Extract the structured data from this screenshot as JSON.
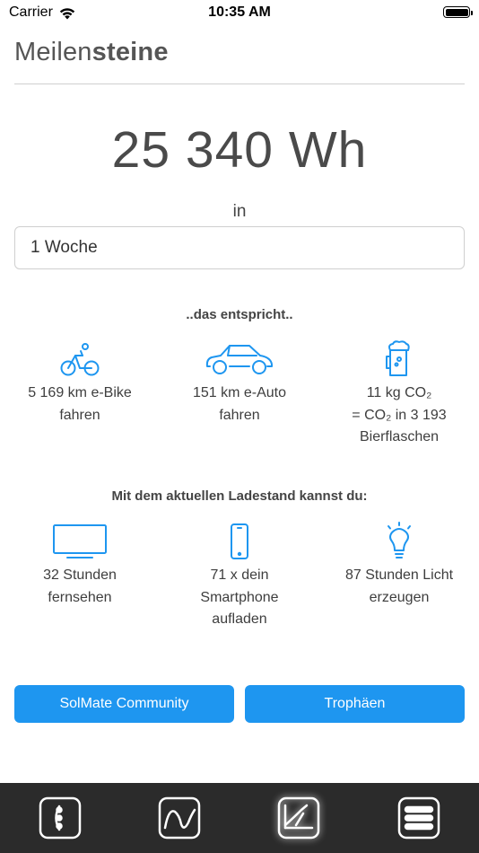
{
  "status_bar": {
    "carrier": "Carrier",
    "time": "10:35 AM"
  },
  "header": {
    "title_regular": "Meilen",
    "title_bold": "steine"
  },
  "energy": {
    "value": "25 340 Wh",
    "in_label": "in"
  },
  "period_select": {
    "value": "1 Woche"
  },
  "equivalents": {
    "heading": "..das entspricht..",
    "items": [
      {
        "icon": "bicycle-icon",
        "lines": [
          "5 169 km e-Bike",
          "fahren"
        ]
      },
      {
        "icon": "car-icon",
        "lines": [
          "151 km e-Auto",
          "fahren"
        ]
      },
      {
        "icon": "beer-mug-icon",
        "lines": [
          "11 kg CO₂",
          "= CO₂ in 3 193",
          "Bierflaschen"
        ]
      }
    ]
  },
  "capabilities": {
    "heading": "Mit dem aktuellen Ladestand kannst du:",
    "items": [
      {
        "icon": "tv-icon",
        "lines": [
          "32 Stunden",
          "fernsehen"
        ]
      },
      {
        "icon": "smartphone-icon",
        "lines": [
          "71 x dein",
          "Smartphone",
          "aufladen"
        ]
      },
      {
        "icon": "lightbulb-icon",
        "lines": [
          "87 Stunden Licht",
          "erzeugen"
        ]
      }
    ]
  },
  "buttons": {
    "community": "SolMate Community",
    "trophies": "Trophäen"
  },
  "tab_bar": {
    "tabs": [
      {
        "icon": "device-status-icon",
        "active": false
      },
      {
        "icon": "wave-chart-icon",
        "active": false
      },
      {
        "icon": "milestones-chart-icon",
        "active": true
      },
      {
        "icon": "menu-icon",
        "active": false
      }
    ]
  },
  "colors": {
    "accent": "#1e96f0",
    "tab_bar_background": "#2b2b2b",
    "text": "#3e3e3e"
  }
}
